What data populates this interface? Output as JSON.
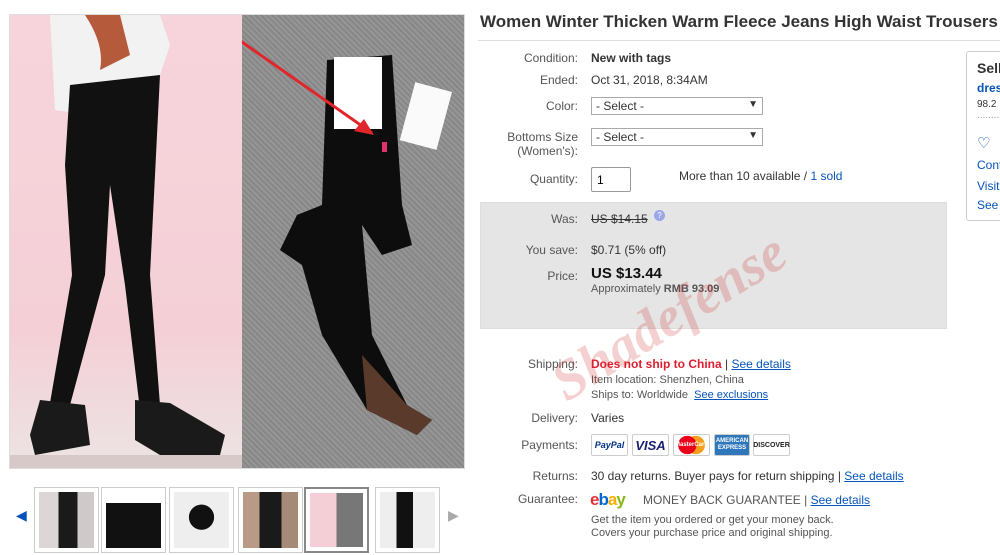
{
  "title": "Women Winter Thicken Warm Fleece Jeans High Waist Trousers Sl",
  "condition": {
    "label": "Condition:",
    "value": "New with tags"
  },
  "ended": {
    "label": "Ended:",
    "value": "Oct 31, 2018, 8:34AM"
  },
  "color": {
    "label": "Color:",
    "selected": "- Select -"
  },
  "size": {
    "label_line1": "Bottoms Size",
    "label_line2": "(Women's):",
    "selected": "- Select -"
  },
  "quantity": {
    "label": "Quantity:",
    "value": "1",
    "available": "More than 10 available /",
    "sold": "1 sold"
  },
  "price": {
    "was_label": "Was:",
    "was_value": "US $14.15",
    "save_label": "You save:",
    "save_value": "$0.71 (5% off)",
    "price_label": "Price:",
    "price_value": "US $13.44",
    "approx_prefix": "Approximately",
    "approx_value": "RMB 93.09"
  },
  "shipping": {
    "label": "Shipping:",
    "no_ship": "Does not ship to China",
    "sep": "|",
    "see_details": "See details",
    "location": "Item location:  Shenzhen, China",
    "ships_to": "Ships to:  Worldwide",
    "see_exclusions": "See exclusions"
  },
  "delivery": {
    "label": "Delivery:",
    "value": "Varies"
  },
  "payments": {
    "label": "Payments:",
    "methods": [
      "PayPal",
      "VISA",
      "MasterCard",
      "AMERICAN EXPRESS",
      "DISCOVER"
    ]
  },
  "returns": {
    "label": "Returns:",
    "value": "30 day returns. Buyer pays for return shipping",
    "sep": "|",
    "see_details": "See details"
  },
  "guarantee": {
    "label": "Guarantee:",
    "logo_letters": [
      "e",
      "b",
      "a",
      "y"
    ],
    "program": "MONEY BACK GUARANTEE",
    "sep": "|",
    "see_details": "See details",
    "line1": "Get the item you ordered or get your money back.",
    "line2": "Covers your purchase price and original shipping."
  },
  "seller": {
    "heading": "Sell",
    "name": "dres",
    "score": "98.2",
    "dots": "........",
    "contact": "Cont",
    "visit": "Visit",
    "see": "See"
  },
  "watermark": "Shadefense",
  "thumbnails_count": 6,
  "colors": {
    "link": "#0654ba",
    "red": "#dd1e31",
    "price_box": "#e5e5e5"
  }
}
